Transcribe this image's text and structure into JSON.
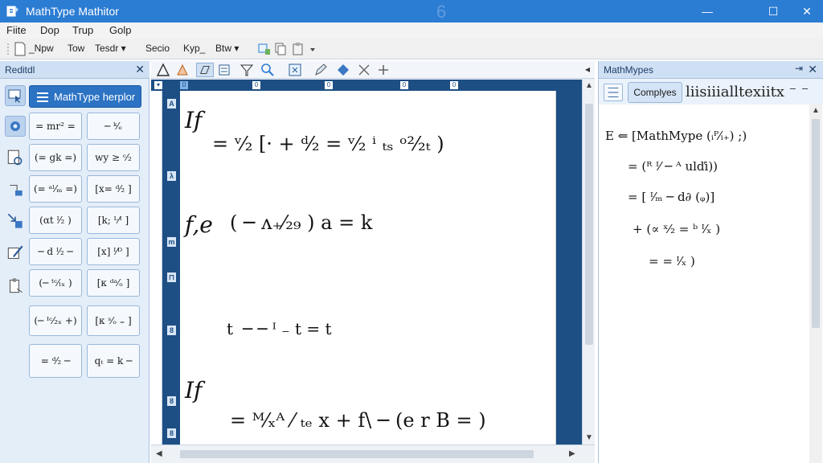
{
  "window": {
    "title": "MathType Mathitor",
    "ghost_char": "6",
    "controls": {
      "minimize": "—",
      "maximize": "☐",
      "close": "✕"
    }
  },
  "menu": [
    "Fiite",
    "Dop",
    "Trup",
    "Golp"
  ],
  "toolbar": {
    "items": [
      "_Npw",
      "Tow",
      "Tesdr ▾",
      "Secio",
      "Kyp_",
      "Btw ▾"
    ]
  },
  "left_panel": {
    "title": "Reditdl",
    "close": "✕",
    "helper_button": "MathType herplor",
    "templates": [
      "= mr² =",
      "─ ᵏ⁄ₑ",
      "(= gk =)",
      "wy ≥ ᶜ⁄₂",
      "(= ᵃˡ⁄ₘ =)",
      "[x= ᵈ⁄₂ ]",
      "(αt ᴵ⁄₂ )",
      "[k; ᴸ⁄ᴵ ]",
      "─ d ᴵ⁄₂ ─",
      "[x] ᴵ⁄ᴰ ]",
      "(─ ᵗᶜ⁄ₗₓ )",
      "[κ ᵈᵃ⁄ₒ ]",
      "(─ ᴵᶜ⁄₂ₓ +)",
      "[κ ˢ⁄ₒ ₌ ]",
      "= ᵈ⁄₂ ─",
      "qₜ = k ─"
    ]
  },
  "editor": {
    "ruler_marks": [
      "▾",
      "0",
      "0",
      "0",
      "0",
      "0"
    ],
    "vruler_marks": [
      "A",
      "λ",
      "m",
      "⊓",
      "8",
      "8",
      "8"
    ],
    "equations": [
      {
        "lead": "If",
        "body": "= ᵛ⁄₂ [· + ᵈ⁄₂ = ᵛ⁄₂ ⁱ ₜₛ ᵒ²⁄₂ₜ )"
      },
      {
        "lead": "f,e",
        "body": "( ─ ᴧ₊⁄₂₉ ) a = k"
      },
      {
        "lead": "t",
        "body": "─ ─ ᴵ ₋ t = t"
      },
      {
        "lead": "If",
        "body": "= ᴹ⁄ₓᴬ ⁄ ₜₑ x + f\\ ─ (e r B = )"
      }
    ]
  },
  "right_panel": {
    "title": "MathMypes",
    "pin": "⇥",
    "close": "✕",
    "tab_label": "Complyes",
    "overflow_text": "liisiiialltexiitx ⁻ ⁻",
    "lines": [
      "E  ⇐ [MathMype (ᵢᴾ⁄ᵢ₊) ;)",
      "= (ᴿ ᴵ⁄ ─ ᴬ ulďi))",
      "= [ ᴵ⁄ₘ ─ d∂ (ᵩ)]",
      "+ (∝ ˣ⁄₂ = ᵇ ᴵ⁄ₓ )",
      "= = ᴵ⁄ₓ )"
    ]
  }
}
